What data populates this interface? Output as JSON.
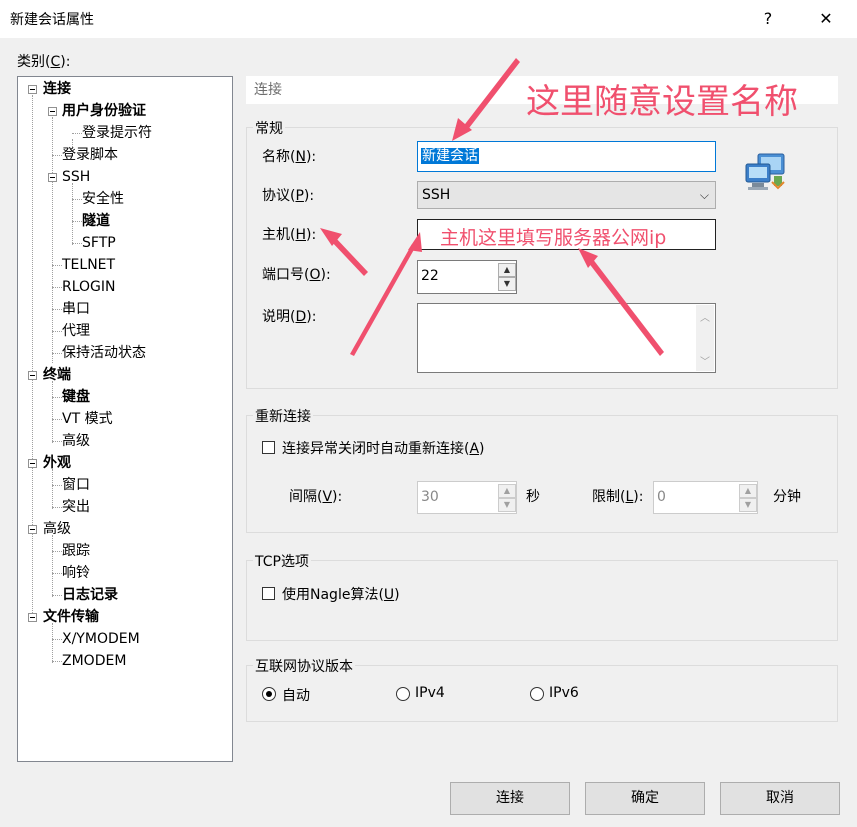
{
  "window": {
    "title": "新建会话属性",
    "help": "?",
    "close": "✕"
  },
  "category": {
    "label_pre": "类别(",
    "label_key": "C",
    "label_post": "):"
  },
  "tree": {
    "items": [
      {
        "label": "连接"
      },
      {
        "label": "用户身份验证"
      },
      {
        "label": "登录提示符"
      },
      {
        "label": "登录脚本"
      },
      {
        "label": "SSH"
      },
      {
        "label": "安全性"
      },
      {
        "label": "隧道"
      },
      {
        "label": "SFTP"
      },
      {
        "label": "TELNET"
      },
      {
        "label": "RLOGIN"
      },
      {
        "label": "串口"
      },
      {
        "label": "代理"
      },
      {
        "label": "保持活动状态"
      },
      {
        "label": "终端"
      },
      {
        "label": "键盘"
      },
      {
        "label": "VT 模式"
      },
      {
        "label": "高级"
      },
      {
        "label": "外观"
      },
      {
        "label": "窗口"
      },
      {
        "label": "突出"
      },
      {
        "label": "高级"
      },
      {
        "label": "跟踪"
      },
      {
        "label": "响铃"
      },
      {
        "label": "日志记录"
      },
      {
        "label": "文件传输"
      },
      {
        "label": "X/YMODEM"
      },
      {
        "label": "ZMODEM"
      }
    ]
  },
  "section_title": "连接",
  "general": {
    "group_label": "常规",
    "name": {
      "pre": "名称(",
      "key": "N",
      "post": "):",
      "value": "新建会话"
    },
    "protocol": {
      "pre": "协议(",
      "key": "P",
      "post": "):",
      "value": "SSH"
    },
    "host": {
      "pre": "主机(",
      "key": "H",
      "post": "):",
      "value": ""
    },
    "port": {
      "pre": "端口号(",
      "key": "O",
      "post": "):",
      "value": "22"
    },
    "desc": {
      "pre": "说明(",
      "key": "D",
      "post": "):",
      "value": ""
    }
  },
  "reconnect": {
    "group_label": "重新连接",
    "checkbox": {
      "pre": "连接异常关闭时自动重新连接(",
      "key": "A",
      "post": ")"
    },
    "interval": {
      "pre": "间隔(",
      "key": "V",
      "post": "):",
      "value": "30",
      "unit": "秒"
    },
    "limit": {
      "pre": "限制(",
      "key": "L",
      "post": "):",
      "value": "0",
      "unit": "分钟"
    }
  },
  "tcp": {
    "group_label": "TCP选项",
    "checkbox": {
      "pre": "使用Nagle算法(",
      "key": "U",
      "post": ")"
    }
  },
  "ipver": {
    "group_label": "互联网协议版本",
    "options": [
      {
        "label": "自动",
        "selected": true
      },
      {
        "label": "IPv4",
        "selected": false
      },
      {
        "label": "IPv6",
        "selected": false
      }
    ]
  },
  "buttons": {
    "connect": "连接",
    "ok": "确定",
    "cancel": "取消"
  },
  "annotations": {
    "name_hint": "这里随意设置名称",
    "host_hint": "主机这里填写服务器公网ip",
    "color": "#f0506e"
  }
}
